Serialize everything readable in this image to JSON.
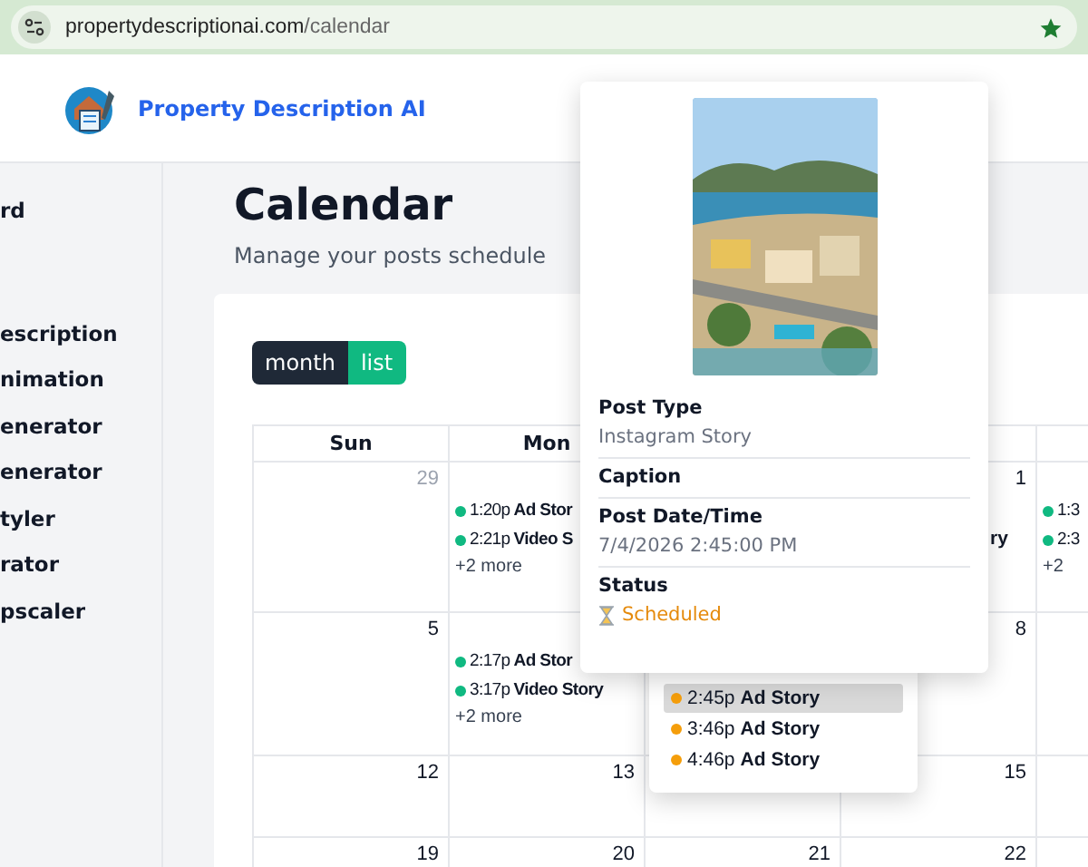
{
  "browser": {
    "host": "propertydescriptionai.com",
    "path": "/calendar"
  },
  "header": {
    "app_name": "Property Description AI"
  },
  "sidebar": {
    "items": [
      "rd",
      "escription",
      "nimation",
      "enerator",
      "enerator",
      "tyler",
      "rator",
      "pscaler"
    ]
  },
  "page": {
    "title": "Calendar",
    "subtitle": "Manage your posts schedule"
  },
  "view_buttons": [
    {
      "label": "month",
      "selected": true
    },
    {
      "label": "list",
      "selected": false
    }
  ],
  "calendar": {
    "columns": [
      "Sun",
      "Mon"
    ],
    "weeks": [
      {
        "sun": {
          "number": "29",
          "muted": true
        },
        "mon": {
          "events": [
            {
              "time": "1:20p",
              "title": "Ad Stor",
              "color": "#10b981"
            },
            {
              "time": "2:21p",
              "title": "Video S",
              "color": "#10b981"
            }
          ],
          "more": "+2 more"
        },
        "wed": {
          "number": "1",
          "muted": false,
          "fragment": "ry"
        },
        "thu": {
          "events": [
            {
              "time": "1:3",
              "color": "#10b981"
            },
            {
              "time": "2:3",
              "color": "#10b981"
            }
          ],
          "more": "+2"
        }
      },
      {
        "sun": {
          "number": "5",
          "muted": false
        },
        "mon": {
          "events": [
            {
              "time": "2:17p",
              "title": "Ad Stor",
              "color": "#10b981"
            },
            {
              "time": "3:17p",
              "title": "Video Story",
              "color": "#10b981"
            }
          ],
          "more": "+2 more"
        },
        "wed": {
          "number": "8",
          "muted": false
        }
      },
      {
        "sun": {
          "number": "12",
          "muted": false
        },
        "mon": {
          "number": "13",
          "muted": false
        },
        "wed": {
          "number": "15",
          "muted": false
        }
      },
      {
        "sun": {
          "number": "19",
          "muted": false
        },
        "mon": {
          "number": "20",
          "muted": false
        },
        "tue": {
          "number": "21",
          "muted": false
        },
        "wed": {
          "number": "22",
          "muted": false
        }
      }
    ]
  },
  "more_popover": {
    "events": [
      {
        "time": "2:45p",
        "title": "Ad Story",
        "color": "#f59e0b",
        "selected": true
      },
      {
        "time": "3:46p",
        "title": "Ad Story",
        "color": "#f59e0b",
        "selected": false
      },
      {
        "time": "4:46p",
        "title": "Ad Story",
        "color": "#f59e0b",
        "selected": false
      }
    ]
  },
  "post_details": {
    "fields": [
      {
        "label": "Post Type",
        "value": "Instagram Story"
      },
      {
        "label": "Caption"
      },
      {
        "label": "Post Date/Time",
        "value": "7/4/2026 2:45:00 PM"
      },
      {
        "label": "Status",
        "value": "Scheduled",
        "kind": "status"
      }
    ]
  }
}
